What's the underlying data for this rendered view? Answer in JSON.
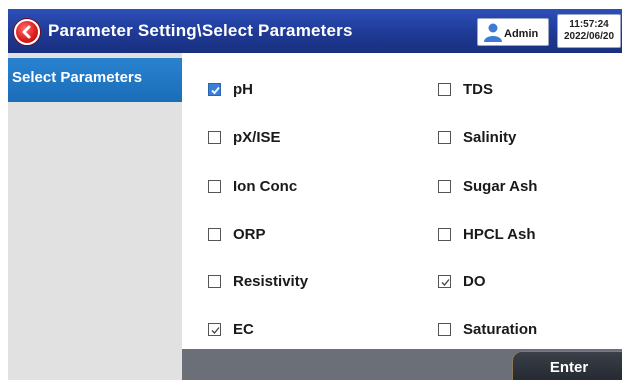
{
  "header": {
    "title": "Parameter Setting\\Select Parameters",
    "user": "Admin",
    "time": "11:57:24",
    "date": "2022/06/20"
  },
  "sidebar": {
    "items": [
      {
        "label": "Select Parameters",
        "selected": true
      }
    ]
  },
  "parameters": {
    "left": [
      {
        "label": "pH",
        "checked": true,
        "style": "filled"
      },
      {
        "label": "pX/ISE",
        "checked": false
      },
      {
        "label": "Ion Conc",
        "checked": false
      },
      {
        "label": "ORP",
        "checked": false
      },
      {
        "label": "Resistivity",
        "checked": false
      },
      {
        "label": "EC",
        "checked": true,
        "style": "outline"
      }
    ],
    "right": [
      {
        "label": "TDS",
        "checked": false
      },
      {
        "label": "Salinity",
        "checked": false
      },
      {
        "label": "Sugar Ash",
        "checked": false
      },
      {
        "label": "HPCL Ash",
        "checked": false
      },
      {
        "label": "DO",
        "checked": true,
        "style": "outline"
      },
      {
        "label": "Saturation",
        "checked": false
      }
    ]
  },
  "footer": {
    "enter_label": "Enter"
  },
  "colors": {
    "header_blue": "#1f3a96",
    "sidebar_selected": "#1a6db8",
    "checkbox_blue": "#3b7fd9",
    "footer_gray": "#6b6f77"
  }
}
